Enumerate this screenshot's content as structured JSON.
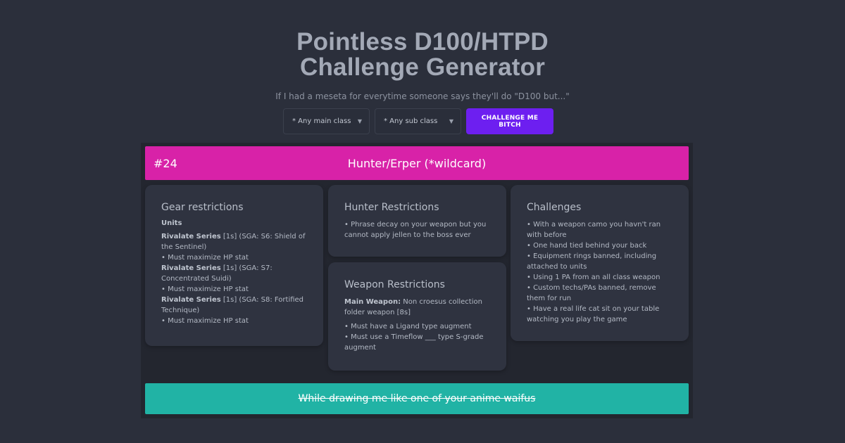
{
  "header": {
    "title_line1": "Pointless D100/HTPD",
    "title_line2": "Challenge Generator",
    "subtitle": "If I had a meseta for everytime someone says they'll do \"D100 but...\""
  },
  "controls": {
    "main_class": "* Any main class",
    "sub_class": "* Any sub class",
    "button_label": "CHALLENGE ME BITCH",
    "chevron_icon": "chevron-down-icon"
  },
  "banner": {
    "number": "#24",
    "title": "Hunter/Erper (*wildcard)",
    "color": "#d822a8"
  },
  "gear": {
    "heading": "Gear restrictions",
    "units_label": "Units",
    "items": [
      {
        "name": "Rivalate Series",
        "detail": " [1s] (SGA: S6: Shield of the Sentinel)",
        "bullet": "• Must maximize HP stat"
      },
      {
        "name": "Rivalate Series",
        "detail": " [1s] (SGA: S7: Concentrated Suidi)",
        "bullet": "• Must maximize HP stat"
      },
      {
        "name": "Rivalate Series",
        "detail": " [1s] (SGA: S8: Fortified Technique)",
        "bullet": "• Must maximize HP stat"
      }
    ]
  },
  "hunter": {
    "heading": "Hunter Restrictions",
    "text": "• Phrase decay on your weapon but you cannot apply jellen to the boss ever"
  },
  "weapon": {
    "heading": "Weapon Restrictions",
    "main_label": "Main Weapon:",
    "main_value": " Non croesus collection folder weapon [8s]",
    "bullet1": "• Must have a Ligand type augment",
    "bullet2": "• Must use a Timeflow ___ type S-grade augment"
  },
  "challenges": {
    "heading": "Challenges",
    "items": [
      "• With a weapon camo you havn't ran with before",
      "• One hand tied behind your back",
      "• Equipment rings banned, including attached to units",
      "• Using 1 PA from an all class weapon",
      "• Custom techs/PAs banned, remove them for run",
      "• Have a real life cat sit on your table watching you play the game"
    ]
  },
  "footer": {
    "text": "While drawing me like one of your anime waifus",
    "color": "#21b3a5"
  },
  "accent_color": "#6d1ff0"
}
